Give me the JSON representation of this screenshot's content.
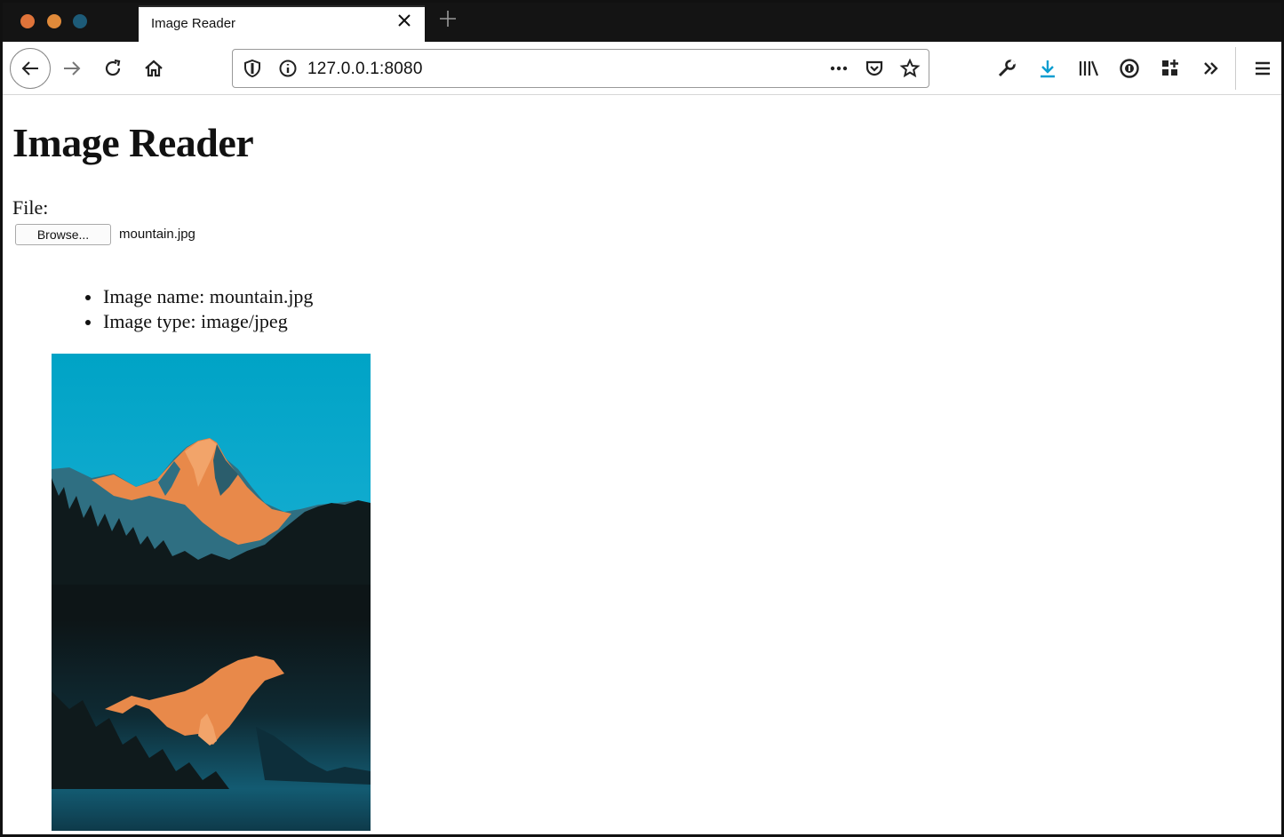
{
  "browser": {
    "tab_title": "Image Reader",
    "url": "127.0.0.1:8080"
  },
  "page": {
    "title": "Image Reader",
    "file_label": "File:",
    "browse_label": "Browse...",
    "selected_file": "mountain.jpg",
    "info": [
      "Image name: mountain.jpg",
      "Image type: image/jpeg"
    ]
  },
  "colors": {
    "sky_top": "#00a5c8",
    "sky_bottom": "#6fcde6",
    "peak_orange": "#e8894a",
    "forest_dark": "#0f1a1c",
    "water_blue": "#0e4f63"
  }
}
